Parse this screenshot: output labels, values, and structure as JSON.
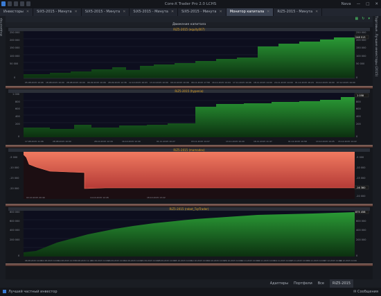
{
  "app": {
    "title": "Core-X Trader Pro 2.0",
    "version": "LCHS",
    "user": "Nava"
  },
  "tabs": [
    {
      "label": "Инвесторы"
    },
    {
      "label": "SiX5-2015 - Минута"
    },
    {
      "label": "SiX5-2015 - Минута"
    },
    {
      "label": "SiX5-2015 - Минута"
    },
    {
      "label": "SiX5-2015 - Минута"
    },
    {
      "label": "Монитор капитала"
    },
    {
      "label": "RiZ5-2015 - Минута"
    }
  ],
  "left_sidebar": {
    "label": "Индикатор"
  },
  "right_sidebar": {
    "label": "Торговые. Лучшие инвесторы (2015)"
  },
  "panel": {
    "title": "Движение капитала"
  },
  "charts": [
    {
      "title": "RiZ5-2015 (equity007)",
      "value_label": "248 513",
      "y_ticks": [
        "250 000",
        "200 000",
        "150 000",
        "100 000",
        "50 000",
        "0"
      ],
      "x_ticks": [
        "05.08.2015 10:06",
        "18.08.2015 10:00",
        "28.08.2015 10:00",
        "06.09.2015 10:06",
        "28.09.2015 12:36",
        "12.10.2015 16:03",
        "13.10.2015 10:00",
        "09.10.2015 10:06",
        "06.11.2015 17:58",
        "16.11.2015 14:04",
        "17.11.2015 10:06",
        "18.11.2015 14:00",
        "24.11.2015 14:00",
        "01.12.2015 16:24",
        "04.12.2015 19:00",
        "07.12.2015 19:00",
        "11.12.2015 10:20"
      ]
    },
    {
      "title": "RiZ5-2015 (hypenia)",
      "value_label": "1 058",
      "y_ticks": [
        "1 000",
        "800",
        "600",
        "400",
        "200",
        "0"
      ],
      "x_ticks": [
        "17.08.2015 11:06",
        "28.08.2015 10:00",
        "28.10.2015 12:16",
        "16.10.2015 12:40",
        "01.11.2015 10:27",
        "03.11.2015 14:07",
        "13.11.2015 10:20",
        "16.11.2015 11:47",
        "01.12.2015 10:58",
        "13.12.2015 14:25",
        "15.12.2015 14:22"
      ]
    },
    {
      "title": "RiZ5-2015 (mamadex)",
      "value_label": "-16 380",
      "y_ticks": [
        "-5 000",
        "-10 000",
        "-15 000",
        "-20 000"
      ],
      "x_ticks": [
        "02.10.2015 20:40",
        "14.10.2015 12:26",
        "18.10.2015 13:22"
      ]
    },
    {
      "title": "RiZ5-2015 (robot_TqrTrader)",
      "value_label": "875 458",
      "y_ticks": [
        "800 000",
        "600 000",
        "400 000",
        "200 000",
        "0"
      ],
      "x_ticks": [
        "06.08.2015 10:06",
        "11.08.2015 10:06",
        "14.08.2015 10:37",
        "20.08.2015 11:10",
        "01.09.2015 10:06",
        "06.09.2015 10:06",
        "14.09.2015 10:06",
        "21.09.2015 10:06",
        "28.09.2015 10:06",
        "05.10.2015 10:06",
        "12.10.2015 10:06",
        "19.10.2015 10:06",
        "26.10.2015 10:06",
        "02.11.2015 10:06",
        "09.11.2015 10:06",
        "16.11.2015 10:06",
        "23.11.2015 10:06",
        "30.11.2015 10:06",
        "07.12.2015 10:06",
        "14.12.2015 10:06"
      ]
    }
  ],
  "statusbar": {
    "item1": "Адаптеры",
    "item2": "Портфели",
    "item3": "Все",
    "item4": "RiZ5-2015"
  },
  "footer": {
    "left": "Лучший частный инвестор",
    "right": "Сообщения"
  },
  "colors": {
    "green_fill": "#1f8a2a",
    "red_fill": "#e06050",
    "background": "#15171c"
  }
}
